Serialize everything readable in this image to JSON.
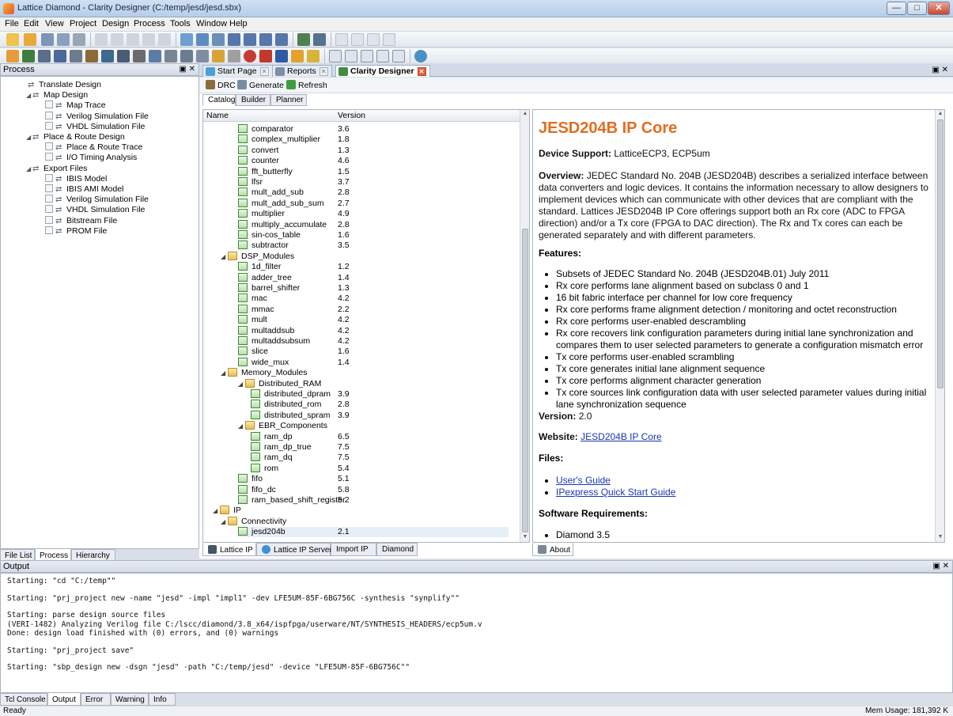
{
  "window": {
    "title": "Lattice Diamond - Clarity Designer (C:/temp/jesd/jesd.sbx)",
    "minimize": "—",
    "maximize": "□",
    "close": "✕"
  },
  "menu": [
    "File",
    "Edit",
    "View",
    "Project",
    "Design",
    "Process",
    "Tools",
    "Window",
    "Help"
  ],
  "process_panel": {
    "title": "Process",
    "controls": "▣ ✕",
    "items": [
      {
        "label": "Translate Design",
        "level": 1,
        "checkbox": false,
        "expand": ""
      },
      {
        "label": "Map Design",
        "level": 0,
        "checkbox": false,
        "expand": "◢"
      },
      {
        "label": "Map Trace",
        "level": 2,
        "checkbox": true,
        "expand": ""
      },
      {
        "label": "Verilog Simulation File",
        "level": 2,
        "checkbox": true,
        "expand": ""
      },
      {
        "label": "VHDL Simulation File",
        "level": 2,
        "checkbox": true,
        "expand": ""
      },
      {
        "label": "Place & Route Design",
        "level": 0,
        "checkbox": false,
        "expand": "◢"
      },
      {
        "label": "Place & Route Trace",
        "level": 2,
        "checkbox": true,
        "expand": ""
      },
      {
        "label": "I/O Timing Analysis",
        "level": 2,
        "checkbox": true,
        "expand": ""
      },
      {
        "label": "Export Files",
        "level": 0,
        "checkbox": false,
        "expand": "◢"
      },
      {
        "label": "IBIS Model",
        "level": 2,
        "checkbox": true,
        "expand": ""
      },
      {
        "label": "IBIS AMI Model",
        "level": 2,
        "checkbox": true,
        "expand": ""
      },
      {
        "label": "Verilog Simulation File",
        "level": 2,
        "checkbox": true,
        "expand": ""
      },
      {
        "label": "VHDL Simulation File",
        "level": 2,
        "checkbox": true,
        "expand": ""
      },
      {
        "label": "Bitstream File",
        "level": 2,
        "checkbox": true,
        "expand": ""
      },
      {
        "label": "PROM File",
        "level": 2,
        "checkbox": true,
        "expand": ""
      }
    ],
    "tabs": [
      "File List",
      "Process",
      "Hierarchy"
    ]
  },
  "doc_tabs": [
    {
      "label": "Start Page",
      "icon_color": "#4d9fd6"
    },
    {
      "label": "Reports",
      "icon_color": "#7c8ea8"
    },
    {
      "label": "Clarity Designer",
      "icon_color": "#3e8e3e"
    }
  ],
  "doc_controls": "▣ ✕",
  "designer": {
    "actions": [
      "DRC",
      "Generate",
      "Refresh"
    ],
    "subtabs": [
      "Catalog",
      "Builder",
      "Planner"
    ],
    "catalog_columns": {
      "name": "Name",
      "version": "Version"
    },
    "catalog_rows": [
      {
        "name": "comparator",
        "version": "3.6",
        "indent": 2,
        "type": "ip"
      },
      {
        "name": "complex_multiplier",
        "version": "1.8",
        "indent": 2,
        "type": "ip"
      },
      {
        "name": "convert",
        "version": "1.3",
        "indent": 2,
        "type": "ip"
      },
      {
        "name": "counter",
        "version": "4.6",
        "indent": 2,
        "type": "ip"
      },
      {
        "name": "fft_butterfly",
        "version": "1.5",
        "indent": 2,
        "type": "ip"
      },
      {
        "name": "lfsr",
        "version": "3.7",
        "indent": 2,
        "type": "ip"
      },
      {
        "name": "mult_add_sub",
        "version": "2.8",
        "indent": 2,
        "type": "ip"
      },
      {
        "name": "mult_add_sub_sum",
        "version": "2.7",
        "indent": 2,
        "type": "ip"
      },
      {
        "name": "multiplier",
        "version": "4.9",
        "indent": 2,
        "type": "ip"
      },
      {
        "name": "multiply_accumulate",
        "version": "2.8",
        "indent": 2,
        "type": "ip"
      },
      {
        "name": "sin-cos_table",
        "version": "1.6",
        "indent": 2,
        "type": "ip"
      },
      {
        "name": "subtractor",
        "version": "3.5",
        "indent": 2,
        "type": "ip"
      },
      {
        "name": "DSP_Modules",
        "version": "",
        "indent": 1,
        "type": "folder"
      },
      {
        "name": "1d_filter",
        "version": "1.2",
        "indent": 2,
        "type": "ip"
      },
      {
        "name": "adder_tree",
        "version": "1.4",
        "indent": 2,
        "type": "ip"
      },
      {
        "name": "barrel_shifter",
        "version": "1.3",
        "indent": 2,
        "type": "ip"
      },
      {
        "name": "mac",
        "version": "4.2",
        "indent": 2,
        "type": "ip"
      },
      {
        "name": "mmac",
        "version": "2.2",
        "indent": 2,
        "type": "ip"
      },
      {
        "name": "mult",
        "version": "4.2",
        "indent": 2,
        "type": "ip"
      },
      {
        "name": "multaddsub",
        "version": "4.2",
        "indent": 2,
        "type": "ip"
      },
      {
        "name": "multaddsubsum",
        "version": "4.2",
        "indent": 2,
        "type": "ip"
      },
      {
        "name": "slice",
        "version": "1.6",
        "indent": 2,
        "type": "ip"
      },
      {
        "name": "wide_mux",
        "version": "1.4",
        "indent": 2,
        "type": "ip"
      },
      {
        "name": "Memory_Modules",
        "version": "",
        "indent": 1,
        "type": "folder"
      },
      {
        "name": "Distributed_RAM",
        "version": "",
        "indent": 2,
        "type": "folder"
      },
      {
        "name": "distributed_dpram",
        "version": "3.9",
        "indent": 3,
        "type": "ip"
      },
      {
        "name": "distributed_rom",
        "version": "2.8",
        "indent": 3,
        "type": "ip"
      },
      {
        "name": "distributed_spram",
        "version": "3.9",
        "indent": 3,
        "type": "ip"
      },
      {
        "name": "EBR_Components",
        "version": "",
        "indent": 2,
        "type": "folder"
      },
      {
        "name": "ram_dp",
        "version": "6.5",
        "indent": 3,
        "type": "ip"
      },
      {
        "name": "ram_dp_true",
        "version": "7.5",
        "indent": 3,
        "type": "ip"
      },
      {
        "name": "ram_dq",
        "version": "7.5",
        "indent": 3,
        "type": "ip"
      },
      {
        "name": "rom",
        "version": "5.4",
        "indent": 3,
        "type": "ip"
      },
      {
        "name": "fifo",
        "version": "5.1",
        "indent": 2,
        "type": "ip"
      },
      {
        "name": "fifo_dc",
        "version": "5.8",
        "indent": 2,
        "type": "ip"
      },
      {
        "name": "ram_based_shift_register",
        "version": "5.2",
        "indent": 2,
        "type": "ip"
      },
      {
        "name": "IP",
        "version": "",
        "indent": 0,
        "type": "folder"
      },
      {
        "name": "Connectivity",
        "version": "",
        "indent": 1,
        "type": "folder"
      },
      {
        "name": "jesd204b",
        "version": "2.1",
        "indent": 2,
        "type": "ip",
        "selected": true
      }
    ],
    "catalog_tabs": [
      "Lattice IP",
      "Lattice IP Server",
      "Import IP",
      "Diamond"
    ],
    "about_tab": "About",
    "about": {
      "title": "JESD204B IP Core",
      "device_label": "Device Support:",
      "device_value": "LatticeECP3, ECP5um",
      "overview_label": "Overview:",
      "overview_lines": [
        "JEDEC Standard No. 204B (JESD204B) describes a serialized interface between",
        "data converters and logic devices.  It contains the information necessary to allow designers to",
        "implement devices which can communicate with other devices that are compliant with the",
        "standard. Lattices JESD204B IP Core offerings support both an Rx core (ADC to FPGA",
        "direction) and/or a Tx core (FPGA to DAC direction). The Rx and Tx cores can each be",
        "generated separately and with different parameters."
      ],
      "features_label": "Features:",
      "features": [
        [
          "Subsets of JEDEC Standard No. 204B (JESD204B.01)  July 2011"
        ],
        [
          "Rx core performs lane alignment based on subclass 0 and 1"
        ],
        [
          "16 bit fabric interface per channel for low core frequency"
        ],
        [
          "Rx core performs frame alignment detection / monitoring and octet reconstruction"
        ],
        [
          "Rx core performs user-enabled descrambling"
        ],
        [
          "Rx core recovers link configuration parameters during initial lane synchronization and",
          "compares them to user selected parameters to generate a configuration mismatch error"
        ],
        [
          "Tx core performs user-enabled scrambling"
        ],
        [
          "Tx core generates initial lane alignment sequence"
        ],
        [
          "Tx core performs alignment character generation"
        ],
        [
          "Tx core sources link configuration data with user selected parameter values during initial",
          "lane synchronization sequence"
        ]
      ],
      "version_label": "Version:",
      "version_value": "2.0",
      "website_label": "Website:",
      "website_link": "JESD204B IP Core",
      "files_label": "Files:",
      "files": [
        "User's Guide",
        "IPexpress Quick Start Guide"
      ],
      "software_label": "Software Requirements:",
      "software": [
        "Diamond 3.5"
      ]
    }
  },
  "output_panel": {
    "title": "Output",
    "controls": "▣ ✕",
    "lines": [
      "Starting: \"cd \"C:/temp\"\"",
      "",
      "Starting: \"prj_project new -name \"jesd\" -impl \"impl1\" -dev LFE5UM-85F-6BG756C -synthesis \"synplify\"\"",
      "",
      "Starting: parse design source files",
      "(VERI-1482) Analyzing Verilog file C:/lscc/diamond/3.8_x64/ispfpga/userware/NT/SYNTHESIS_HEADERS/ecp5um.v",
      "Done: design load finished with (0) errors, and (0) warnings",
      "",
      "Starting: \"prj_project save\"",
      "",
      "Starting: \"sbp_design new -dsgn \"jesd\" -path \"C:/temp/jesd\" -device \"LFE5UM-85F-6BG756C\"\""
    ],
    "tabs": [
      "Tcl Console",
      "Output",
      "Error",
      "Warning",
      "Info"
    ]
  },
  "status": {
    "left": "Ready",
    "right": "Mem Usage: 181,392 K"
  }
}
